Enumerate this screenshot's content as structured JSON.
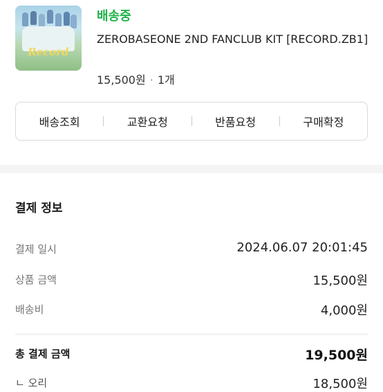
{
  "order": {
    "status": "배송중",
    "product_name": "ZEROBASEONE 2ND FANCLUB KIT [RECORD.ZB1]",
    "price": "15,500원",
    "separator": "·",
    "quantity": "1개"
  },
  "actions": [
    {
      "label": "배송조회"
    },
    {
      "label": "교환요청"
    },
    {
      "label": "반품요청"
    },
    {
      "label": "구매확정"
    }
  ],
  "payment": {
    "title": "결제 정보",
    "rows": [
      {
        "key": "결제 일시",
        "value": "2024.06.07 20:01:45"
      },
      {
        "key": "상품 금액",
        "value": "15,500원"
      },
      {
        "key": "배송비",
        "value": "4,000원"
      }
    ],
    "total": {
      "key": "총 결제 금액",
      "value": "19,500원"
    },
    "sub": {
      "key": "ㄴ 오리",
      "value": "18,500원"
    }
  },
  "colors": {
    "status": "#1fb14a"
  }
}
